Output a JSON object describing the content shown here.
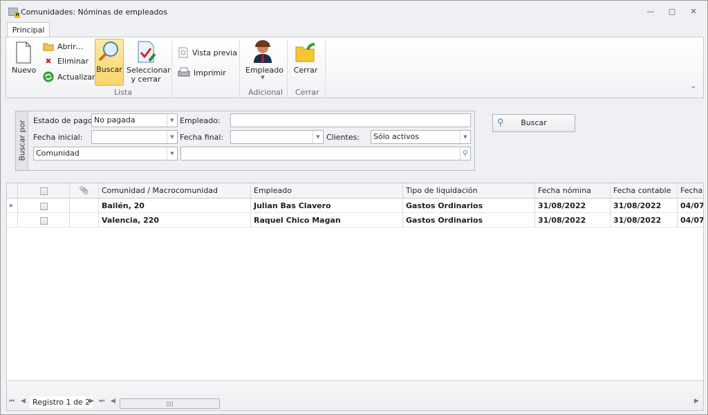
{
  "window": {
    "title": "Comunidades: Nóminas de empleados",
    "minimize": "—",
    "restore": "▢",
    "close": "✕"
  },
  "ribbon": {
    "tab": "Principal",
    "buttons": {
      "nuevo": "Nuevo",
      "abrir": "Abrir…",
      "eliminar": "Eliminar",
      "actualizar": "Actualizar",
      "buscar": "Buscar",
      "seleccionar": "Seleccionar",
      "seleccionar2": "y cerrar",
      "vista_previa": "Vista previa",
      "imprimir": "Imprimir",
      "empleado": "Empleado",
      "cerrar": "Cerrar"
    },
    "groups": {
      "lista": "Lista",
      "adicional": "Adicional",
      "cerrar": "Cerrar"
    },
    "collapse": "⌃"
  },
  "filter": {
    "side_label": "Buscar por",
    "estado_label": "Estado de pago:",
    "estado_value": "No pagada",
    "empleado_label": "Empleado:",
    "empleado_value": "",
    "fecha_inicial_label": "Fecha inicial:",
    "fecha_inicial_value": "",
    "fecha_final_label": "Fecha final:",
    "fecha_final_value": "",
    "clientes_label": "Clientes:",
    "clientes_value": "Sólo activos",
    "campo_value": "Comunidad",
    "texto_value": "",
    "buscar_button": "Buscar"
  },
  "grid": {
    "columns": [
      "Comunidad / Macrocomunidad",
      "Empleado",
      "Tipo de liquidación",
      "Fecha nómina",
      "Fecha contable",
      "Fecha"
    ],
    "rows": [
      {
        "comunidad": "Bailén, 20",
        "empleado": "Julian Bas Clavero",
        "tipo": "Gastos Ordinarios",
        "fecha_nomina": "31/08/2022",
        "fecha_contable": "31/08/2022",
        "fecha": "04/07"
      },
      {
        "comunidad": "Valencia, 220",
        "empleado": "Raquel Chico Magan",
        "tipo": "Gastos Ordinarios",
        "fecha_nomina": "31/08/2022",
        "fecha_contable": "31/08/2022",
        "fecha": "04/07"
      }
    ]
  },
  "footer": {
    "record": "Registro 1 de 2"
  }
}
